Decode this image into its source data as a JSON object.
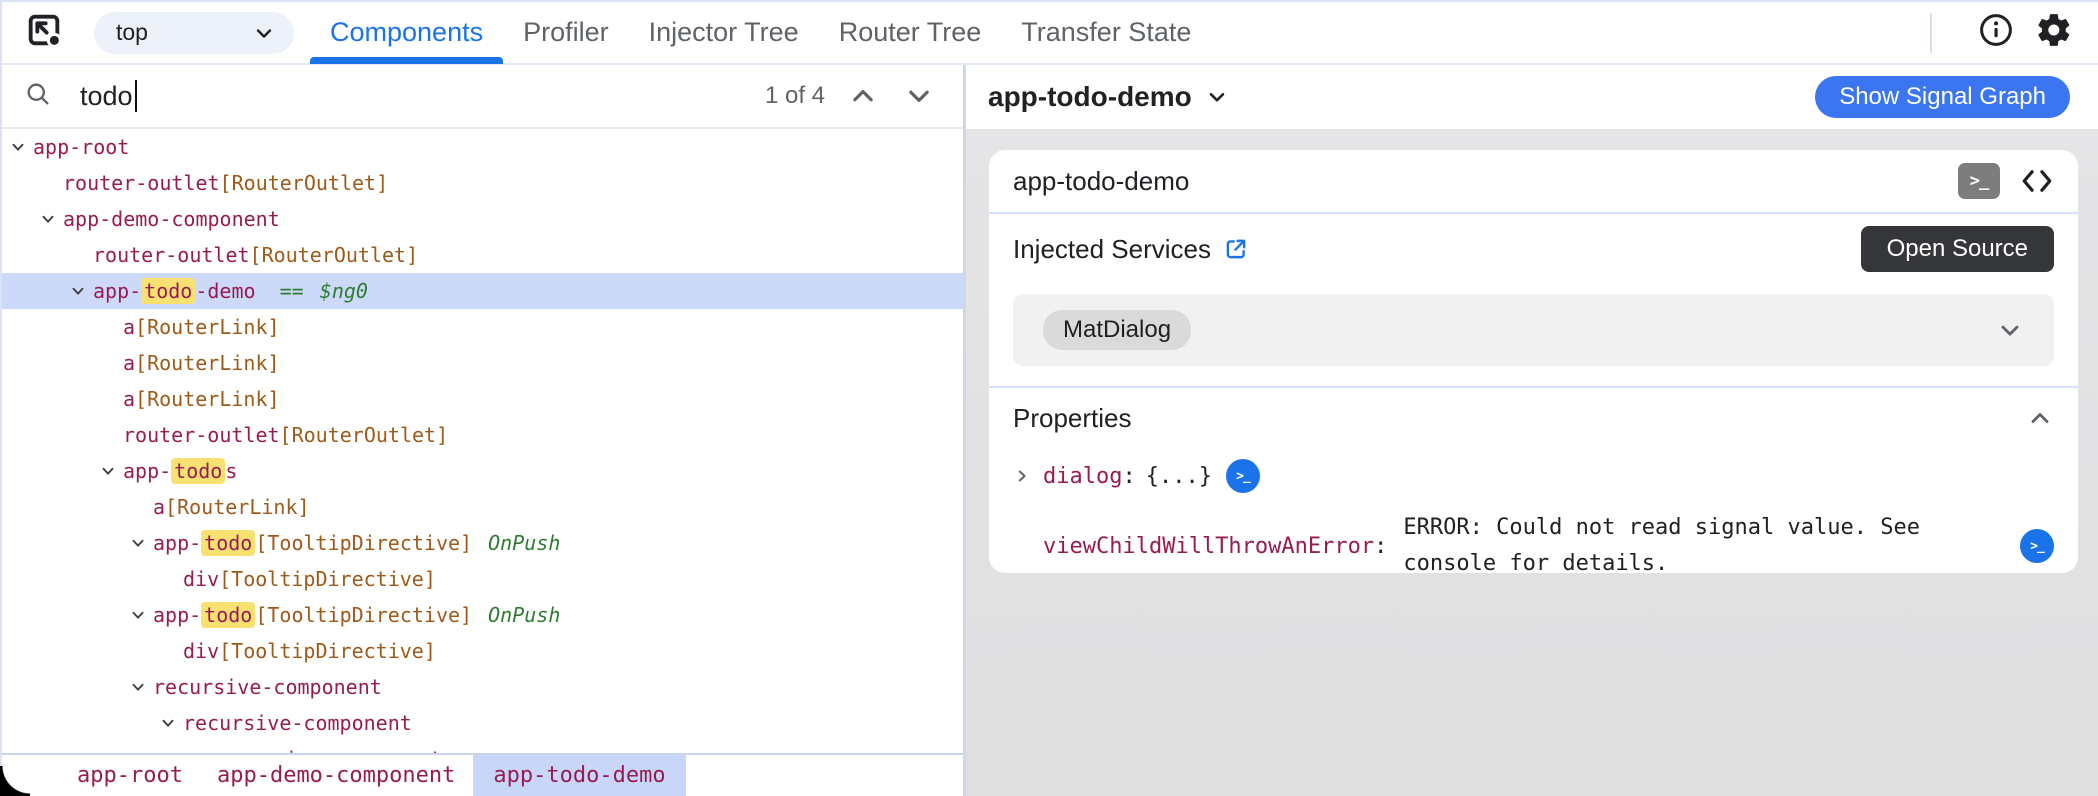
{
  "topbar": {
    "frame_selector": {
      "value": "top"
    },
    "tabs": [
      {
        "label": "Components",
        "active": true
      },
      {
        "label": "Profiler",
        "active": false
      },
      {
        "label": "Injector Tree",
        "active": false
      },
      {
        "label": "Router Tree",
        "active": false
      },
      {
        "label": "Transfer State",
        "active": false
      }
    ],
    "icons": [
      "inspect-target-icon",
      "info-icon",
      "gear-icon"
    ]
  },
  "search": {
    "value": "todo",
    "result_count": "1 of 4"
  },
  "tree": {
    "rows": [
      {
        "depth": 0,
        "twistie": true,
        "selected": false,
        "segments": [
          [
            "el",
            "app-root"
          ]
        ]
      },
      {
        "depth": 1,
        "twistie": false,
        "selected": false,
        "segments": [
          [
            "el",
            "router-outlet"
          ],
          [
            "dir",
            "[RouterOutlet]"
          ]
        ]
      },
      {
        "depth": 1,
        "twistie": true,
        "selected": false,
        "segments": [
          [
            "el",
            "app-demo-component"
          ]
        ]
      },
      {
        "depth": 2,
        "twistie": false,
        "selected": false,
        "segments": [
          [
            "el",
            "router-outlet"
          ],
          [
            "dir",
            "[RouterOutlet]"
          ]
        ]
      },
      {
        "depth": 2,
        "twistie": true,
        "selected": true,
        "segments": [
          [
            "el",
            "app-"
          ],
          [
            "hl",
            "todo"
          ],
          [
            "el",
            "-demo"
          ],
          [
            "grn",
            "  == "
          ],
          [
            "grni",
            "$ng0"
          ]
        ]
      },
      {
        "depth": 3,
        "twistie": false,
        "selected": false,
        "segments": [
          [
            "el",
            "a"
          ],
          [
            "dir",
            "[RouterLink]"
          ]
        ]
      },
      {
        "depth": 3,
        "twistie": false,
        "selected": false,
        "segments": [
          [
            "el",
            "a"
          ],
          [
            "dir",
            "[RouterLink]"
          ]
        ]
      },
      {
        "depth": 3,
        "twistie": false,
        "selected": false,
        "segments": [
          [
            "el",
            "a"
          ],
          [
            "dir",
            "[RouterLink]"
          ]
        ]
      },
      {
        "depth": 3,
        "twistie": false,
        "selected": false,
        "segments": [
          [
            "el",
            "router-outlet"
          ],
          [
            "dir",
            "[RouterOutlet]"
          ]
        ]
      },
      {
        "depth": 3,
        "twistie": true,
        "selected": false,
        "segments": [
          [
            "el",
            "app-"
          ],
          [
            "hl",
            "todo"
          ],
          [
            "el",
            "s"
          ]
        ]
      },
      {
        "depth": 4,
        "twistie": false,
        "selected": false,
        "segments": [
          [
            "el",
            "a"
          ],
          [
            "dir",
            "[RouterLink]"
          ]
        ]
      },
      {
        "depth": 4,
        "twistie": true,
        "selected": false,
        "segments": [
          [
            "el",
            "app-"
          ],
          [
            "hl",
            "todo"
          ],
          [
            "dir",
            "[TooltipDirective]"
          ],
          [
            "grni",
            " OnPush"
          ]
        ]
      },
      {
        "depth": 5,
        "twistie": false,
        "selected": false,
        "segments": [
          [
            "el",
            "div"
          ],
          [
            "dir",
            "[TooltipDirective]"
          ]
        ]
      },
      {
        "depth": 4,
        "twistie": true,
        "selected": false,
        "segments": [
          [
            "el",
            "app-"
          ],
          [
            "hl",
            "todo"
          ],
          [
            "dir",
            "[TooltipDirective]"
          ],
          [
            "grni",
            " OnPush"
          ]
        ]
      },
      {
        "depth": 5,
        "twistie": false,
        "selected": false,
        "segments": [
          [
            "el",
            "div"
          ],
          [
            "dir",
            "[TooltipDirective]"
          ]
        ]
      },
      {
        "depth": 4,
        "twistie": true,
        "selected": false,
        "segments": [
          [
            "el",
            "recursive-component"
          ]
        ]
      },
      {
        "depth": 5,
        "twistie": true,
        "selected": false,
        "segments": [
          [
            "el",
            "recursive-component"
          ]
        ]
      },
      {
        "depth": 6,
        "twistie": true,
        "selected": false,
        "segments": [
          [
            "el",
            "recursive-component"
          ]
        ]
      }
    ]
  },
  "breadcrumb": {
    "items": [
      {
        "label": "app-root",
        "selected": false
      },
      {
        "label": "app-demo-component",
        "selected": false
      },
      {
        "label": "app-todo-demo",
        "selected": true
      }
    ]
  },
  "details": {
    "title": "app-todo-demo",
    "signal_graph_button": "Show Signal Graph",
    "card_title": "app-todo-demo",
    "injected_services": {
      "label": "Injected Services",
      "open_source_button": "Open Source",
      "services": [
        "MatDialog"
      ]
    },
    "properties": {
      "label": "Properties",
      "rows": [
        {
          "name": "dialog",
          "value": "{...}",
          "expandable": true,
          "icon_position": "inline"
        },
        {
          "name": "viewChildWillThrowAnError",
          "value": "ERROR: Could not read signal value. See console for details.",
          "expandable": false,
          "icon_position": "end"
        }
      ]
    }
  },
  "colors": {
    "accent_blue": "#1a73e8",
    "signal_button_blue": "#3b76f0",
    "element_name": "#971c54",
    "directive_name": "#9e5a19",
    "modifier_green": "#2e7d32",
    "search_highlight": "#f8e170",
    "selected_row": "#cdd9f8",
    "dark_button": "#35363a"
  }
}
